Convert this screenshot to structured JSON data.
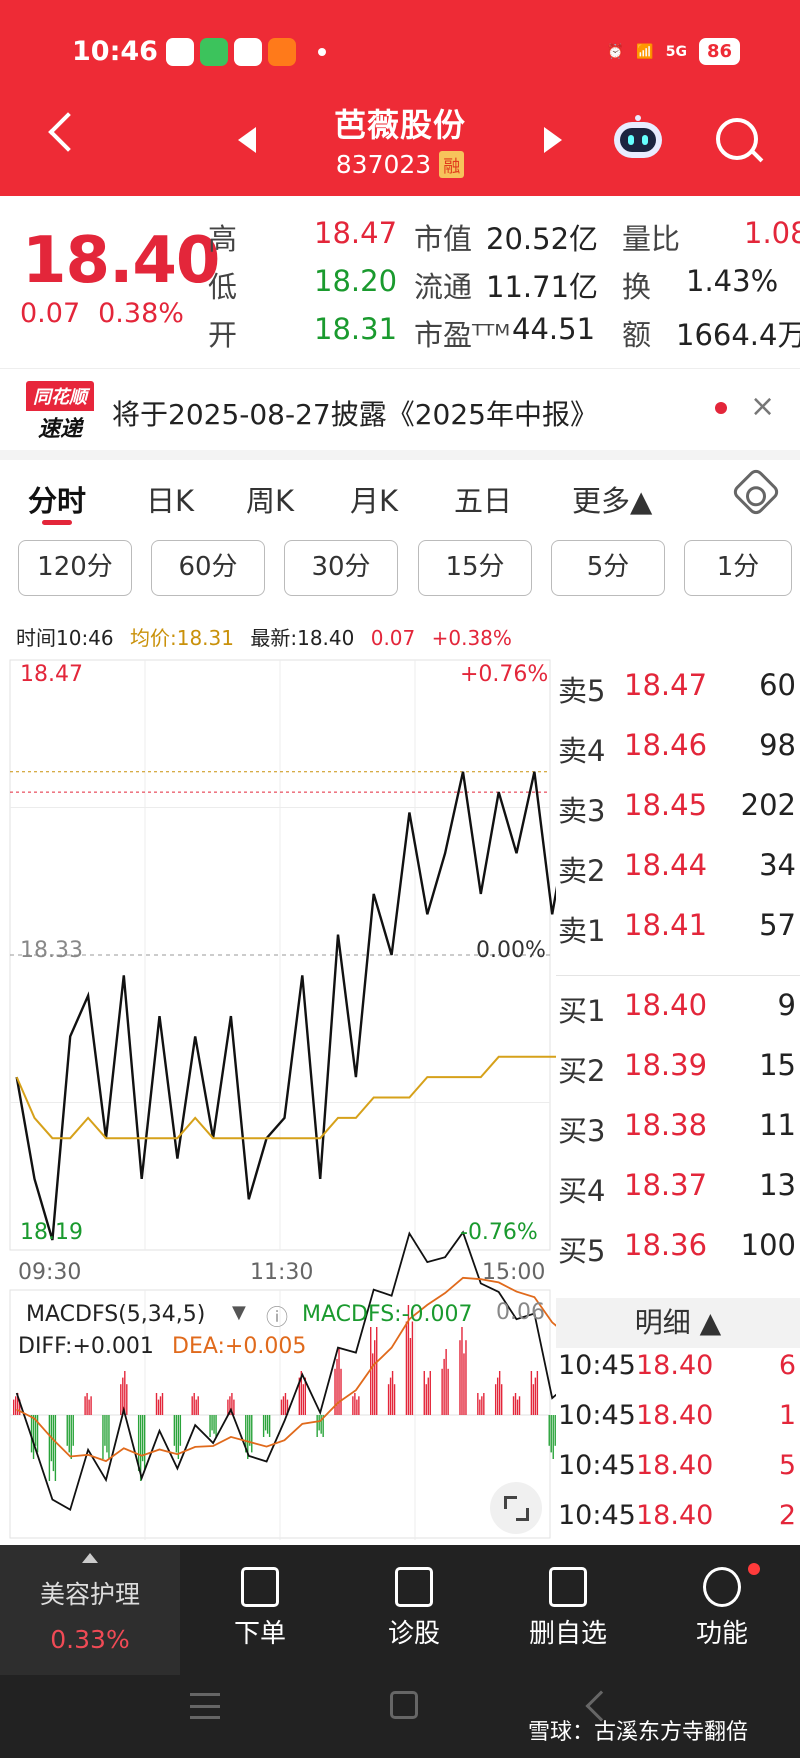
{
  "status": {
    "time": "10:46",
    "signal": "5G",
    "battery": "86"
  },
  "header": {
    "name": "芭薇股份",
    "code": "837023",
    "badge": "融"
  },
  "quote": {
    "price": "18.40",
    "change": "0.07",
    "change_pct": "0.38%",
    "rows": [
      {
        "l1": "高",
        "v1": "18.47",
        "l2": "市值",
        "v2": "20.52亿",
        "l3": "量比",
        "v3": "1.08"
      },
      {
        "l1": "低",
        "v1": "18.20",
        "l2": "流通",
        "v2": "11.71亿",
        "l3": "换",
        "v3": "1.43%"
      },
      {
        "l1": "开",
        "v1": "18.31",
        "l2": "市盈ᵀᵀᴹ",
        "v2": "44.51",
        "l3": "额",
        "v3": "1664.4万"
      }
    ]
  },
  "notice": {
    "logo_top": "同花顺",
    "logo_bottom": "速递",
    "text": "将于2025-08-27披露《2025年中报》",
    "close": "×"
  },
  "tabs": [
    "分时",
    "日K",
    "周K",
    "月K",
    "五日",
    "更多▲"
  ],
  "periods": [
    "120分",
    "60分",
    "30分",
    "15分",
    "5分",
    "1分"
  ],
  "info": {
    "time": "时间10:46",
    "avg": "均价:18.31",
    "latest": "最新:18.40",
    "chg": "0.07",
    "pct": "+0.38%"
  },
  "chart_data": {
    "type": "line",
    "title": "",
    "y_labels": {
      "top": "18.47",
      "mid": "18.33",
      "bottom": "18.19",
      "top_pct": "+0.76%",
      "mid_pct": "0.00%",
      "bottom_pct": "-0.76%"
    },
    "x_labels": [
      "09:30",
      "11:30",
      "15:00"
    ],
    "ylim": [
      18.19,
      18.47
    ],
    "reference": 18.33,
    "series": [
      {
        "name": "",
        "values": [
          18.27,
          18.22,
          18.19,
          18.29,
          18.31,
          18.24,
          18.32,
          18.22,
          18.3,
          18.23,
          18.29,
          18.24,
          18.3,
          18.21,
          18.24,
          18.25,
          18.32,
          18.22,
          18.34,
          18.27,
          18.36,
          18.33,
          18.4,
          18.35,
          18.38,
          18.42,
          18.36,
          18.41,
          18.38,
          18.42,
          18.35,
          18.4,
          18.36,
          18.46,
          18.47,
          18.45,
          18.42,
          18.46,
          18.43,
          18.44,
          18.39,
          18.42,
          18.4,
          18.41
        ]
      },
      {
        "name": "",
        "values": [
          18.27,
          18.25,
          18.24,
          18.24,
          18.25,
          18.24,
          18.24,
          18.24,
          18.24,
          18.24,
          18.25,
          18.24,
          18.24,
          18.24,
          18.24,
          18.24,
          18.24,
          18.24,
          18.25,
          18.25,
          18.26,
          18.26,
          18.26,
          18.27,
          18.27,
          18.27,
          18.27,
          18.28,
          18.28,
          18.28,
          18.28,
          18.28,
          18.28,
          18.29,
          18.29,
          18.29,
          18.3,
          18.3,
          18.3,
          18.3,
          18.3,
          18.31,
          18.31,
          18.31
        ]
      }
    ],
    "macd": {
      "label": "MACDFS(5,34,5)",
      "value_label": "MACDFS:-0.007",
      "diff": "DIFF:+0.001",
      "dea": "DEA:+0.005",
      "scale": "0.06",
      "bars": [
        0.01,
        -0.02,
        -0.03,
        -0.02,
        0.01,
        -0.02,
        0.02,
        -0.03,
        0.01,
        -0.02,
        0.01,
        -0.01,
        0.01,
        -0.02,
        -0.01,
        0.01,
        0.02,
        -0.01,
        0.03,
        0.01,
        0.04,
        0.02,
        0.05,
        0.02,
        0.03,
        0.04,
        0.01,
        0.02,
        0.01,
        0.02,
        -0.02,
        0.01,
        -0.01,
        0.03,
        0.04,
        0.02,
        0.01,
        0.02,
        -0.01,
        -0.02,
        -0.03,
        -0.02,
        -0.03,
        -0.02
      ]
    }
  },
  "orderbook": {
    "asks": [
      {
        "label": "卖5",
        "price": "18.47",
        "vol": "60"
      },
      {
        "label": "卖4",
        "price": "18.46",
        "vol": "98"
      },
      {
        "label": "卖3",
        "price": "18.45",
        "vol": "202"
      },
      {
        "label": "卖2",
        "price": "18.44",
        "vol": "34"
      },
      {
        "label": "卖1",
        "price": "18.41",
        "vol": "57"
      }
    ],
    "bids": [
      {
        "label": "买1",
        "price": "18.40",
        "vol": "9"
      },
      {
        "label": "买2",
        "price": "18.39",
        "vol": "15"
      },
      {
        "label": "买3",
        "price": "18.38",
        "vol": "11"
      },
      {
        "label": "买4",
        "price": "18.37",
        "vol": "13"
      },
      {
        "label": "买5",
        "price": "18.36",
        "vol": "100"
      }
    ]
  },
  "detail": {
    "title": "明细 ▲",
    "rows": [
      {
        "time": "10:45",
        "price": "18.40",
        "vol": "6"
      },
      {
        "time": "10:45",
        "price": "18.40",
        "vol": "1"
      },
      {
        "time": "10:45",
        "price": "18.40",
        "vol": "5"
      },
      {
        "time": "10:45",
        "price": "18.40",
        "vol": "2"
      }
    ]
  },
  "bottom": {
    "sector_name": "美容护理",
    "sector_pct": "0.33%",
    "items": [
      "下单",
      "诊股",
      "删自选",
      "功能"
    ]
  },
  "watermark": "雪球：古溪东方寺翻倍"
}
